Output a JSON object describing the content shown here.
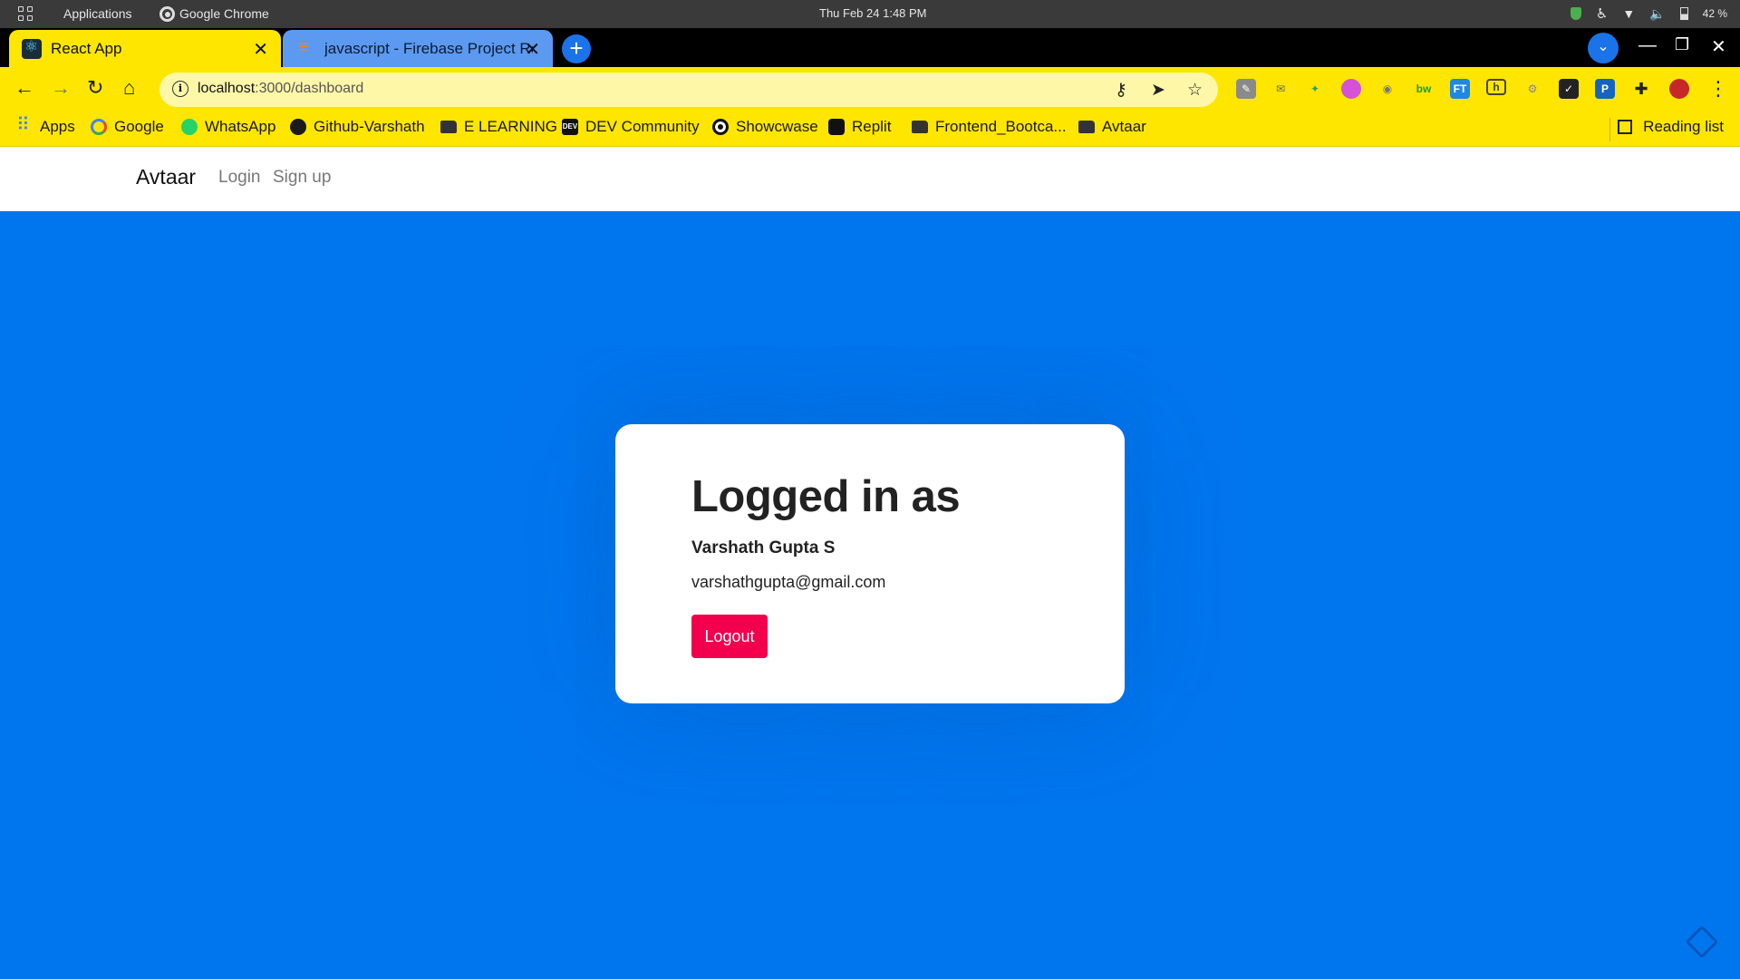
{
  "os": {
    "applications_label": "Applications",
    "chrome_label": "Google Chrome",
    "datetime": "Thu Feb 24   1:48 PM",
    "battery": "42 %"
  },
  "tabs": [
    {
      "title": "React App",
      "active": true
    },
    {
      "title": "javascript - Firebase Project Res",
      "active": false
    }
  ],
  "address_bar": {
    "host": "localhost",
    "path": ":3000/dashboard"
  },
  "bookmarks": [
    {
      "label": "Apps",
      "icon": "apps-grid-icon"
    },
    {
      "label": "Google",
      "icon": "google-icon"
    },
    {
      "label": "WhatsApp",
      "icon": "whatsapp-icon"
    },
    {
      "label": "Github-Varshath",
      "icon": "github-icon"
    },
    {
      "label": "E LEARNING",
      "icon": "folder-icon"
    },
    {
      "label": "DEV Community",
      "icon": "dev-icon"
    },
    {
      "label": "Showcwase",
      "icon": "showcase-icon"
    },
    {
      "label": "Replit",
      "icon": "replit-icon"
    },
    {
      "label": "Frontend_Bootca...",
      "icon": "folder-icon"
    },
    {
      "label": "Avtaar",
      "icon": "folder-icon"
    }
  ],
  "reading_list": "Reading list",
  "app": {
    "brand": "Avtaar",
    "nav": [
      "Login",
      "Sign up"
    ]
  },
  "card": {
    "heading": "Logged in as",
    "name": "Varshath Gupta S",
    "email": "varshathgupta@gmail.com",
    "logout_label": "Logout"
  },
  "colors": {
    "page_bg": "#0076ee",
    "chrome_theme": "#ffe600",
    "logout_button": "#f2004d"
  }
}
